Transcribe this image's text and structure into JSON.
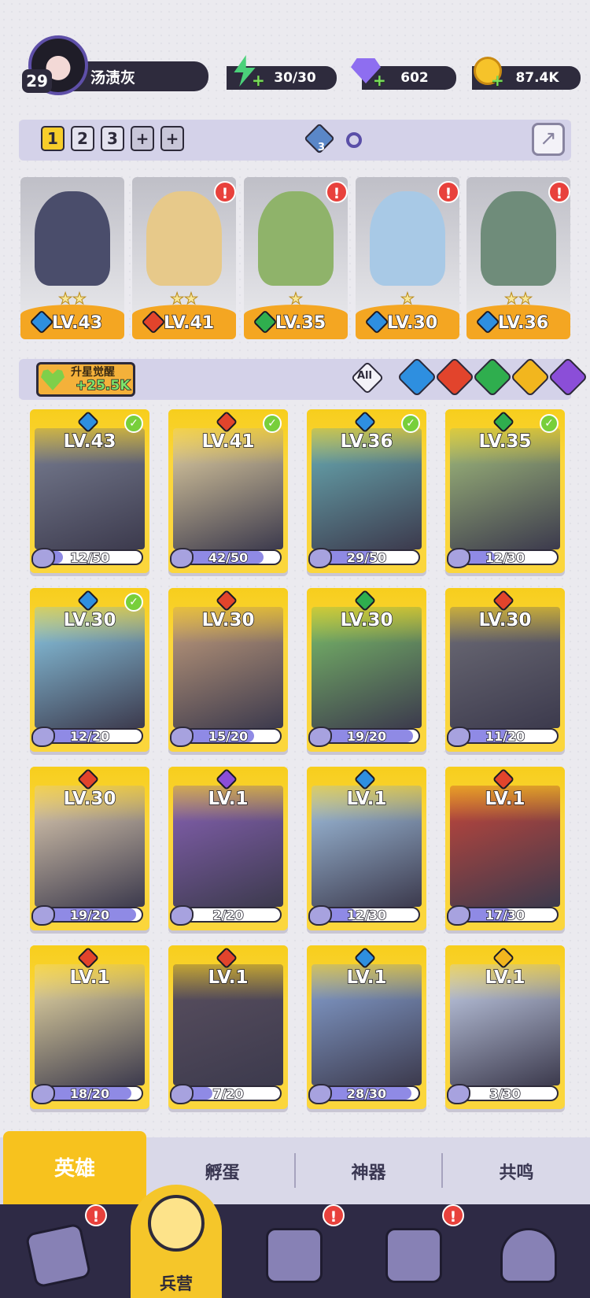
{
  "player": {
    "level": "29",
    "name": "汤渍灰"
  },
  "resources": {
    "energy": "30/30",
    "gems": "602",
    "gold": "87.4K"
  },
  "team_tabs": [
    "1",
    "2",
    "3",
    "+",
    "+"
  ],
  "team_badge": "3",
  "awaken": {
    "label": "升星觉醒",
    "value": "+25.5K"
  },
  "filters": {
    "all": "All"
  },
  "team": [
    {
      "level": "LV.43",
      "element": "water",
      "stars": "★★",
      "alert": false,
      "color": "#4a4d6b"
    },
    {
      "level": "LV.41",
      "element": "fire",
      "stars": "★★",
      "alert": true,
      "color": "#e7c98a"
    },
    {
      "level": "LV.35",
      "element": "wind",
      "stars": "★",
      "alert": true,
      "color": "#8fb36a"
    },
    {
      "level": "LV.30",
      "element": "water",
      "stars": "★",
      "alert": true,
      "color": "#a8c9e6"
    },
    {
      "level": "LV.36",
      "element": "water",
      "stars": "★★",
      "alert": true,
      "color": "#6f8c7a"
    }
  ],
  "heroes": [
    {
      "level": "LV.43",
      "element": "water",
      "progress": "12/50",
      "fill": 0.24,
      "check": true,
      "color": "#7b8195"
    },
    {
      "level": "LV.41",
      "element": "fire",
      "progress": "42/50",
      "fill": 0.84,
      "check": true,
      "color": "#ead7a6"
    },
    {
      "level": "LV.36",
      "element": "water",
      "progress": "29/50",
      "fill": 0.58,
      "check": true,
      "color": "#6bb1b8"
    },
    {
      "level": "LV.35",
      "element": "wind",
      "progress": "12/30",
      "fill": 0.4,
      "check": true,
      "color": "#a6c27e"
    },
    {
      "level": "LV.30",
      "element": "water",
      "progress": "12/20",
      "fill": 0.6,
      "check": true,
      "color": "#8fd0ec"
    },
    {
      "level": "LV.30",
      "element": "fire",
      "progress": "15/20",
      "fill": 0.75,
      "check": false,
      "color": "#c7a07e"
    },
    {
      "level": "LV.30",
      "element": "wind",
      "progress": "19/20",
      "fill": 0.95,
      "check": false,
      "color": "#7cc26a"
    },
    {
      "level": "LV.30",
      "element": "fire",
      "progress": "11/20",
      "fill": 0.55,
      "check": false,
      "color": "#6f6e78"
    },
    {
      "level": "LV.30",
      "element": "fire",
      "progress": "19/20",
      "fill": 0.95,
      "check": false,
      "color": "#e6d3b6"
    },
    {
      "level": "LV.1",
      "element": "dark",
      "progress": "2/20",
      "fill": 0.1,
      "check": false,
      "color": "#8a63b8"
    },
    {
      "level": "LV.1",
      "element": "water",
      "progress": "12/30",
      "fill": 0.4,
      "check": false,
      "color": "#a7c8e8"
    },
    {
      "level": "LV.1",
      "element": "fire",
      "progress": "17/30",
      "fill": 0.57,
      "check": false,
      "color": "#c9463a"
    },
    {
      "level": "LV.1",
      "element": "fire",
      "progress": "18/20",
      "fill": 0.9,
      "check": false,
      "color": "#f2e2a8"
    },
    {
      "level": "LV.1",
      "element": "fire",
      "progress": "7/20",
      "fill": 0.35,
      "check": false,
      "color": "#5b5060"
    },
    {
      "level": "LV.1",
      "element": "water",
      "progress": "28/30",
      "fill": 0.93,
      "check": false,
      "color": "#8aa6d8"
    },
    {
      "level": "LV.1",
      "element": "light",
      "progress": "3/30",
      "fill": 0.1,
      "check": false,
      "color": "#cbd6f0"
    }
  ],
  "bottom_tabs": [
    "英雄",
    "孵蛋",
    "神器",
    "共鸣"
  ],
  "nav": {
    "active_label": "兵营",
    "alerts": [
      "!",
      "!",
      "!"
    ]
  },
  "alert_mark": "!",
  "check_mark": "✓",
  "element_colors": {
    "water": "#2e8fe0",
    "fire": "#e2442c",
    "wind": "#2fae4e",
    "light": "#f2b61e",
    "dark": "#8b4ed8"
  }
}
